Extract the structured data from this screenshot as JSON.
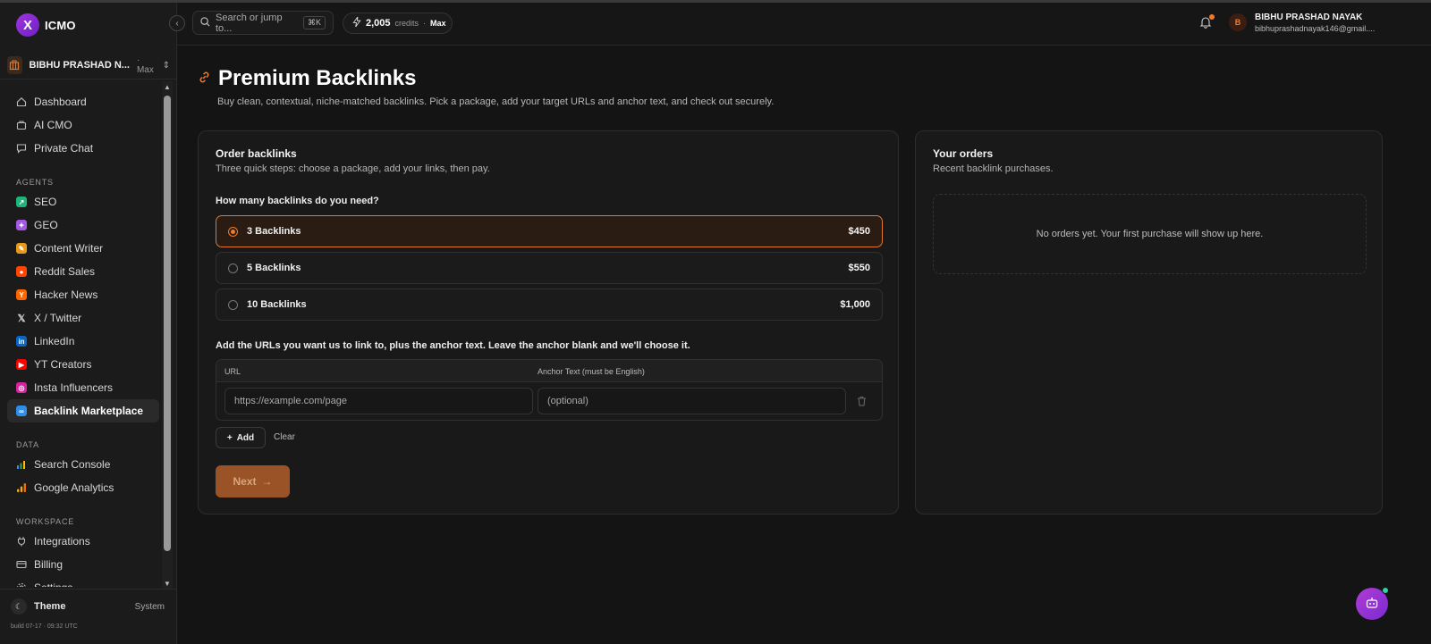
{
  "app": {
    "name": "ICMO",
    "logo_letter": "X",
    "accent": "#f07a2e"
  },
  "workspace": {
    "name": "BIBHU PRASHAD N...",
    "plan": "· Max"
  },
  "sidebar": {
    "main": [
      {
        "label": "Dashboard",
        "icon": "home-icon"
      },
      {
        "label": "AI CMO",
        "icon": "bag-icon"
      },
      {
        "label": "Private Chat",
        "icon": "chat-icon"
      }
    ],
    "agents_title": "AGENTS",
    "agents": [
      {
        "label": "SEO",
        "icon": "seo-icon",
        "color": "#1fb57a",
        "glyph": "↗"
      },
      {
        "label": "GEO",
        "icon": "geo-icon",
        "color": "#a45ae0",
        "glyph": "✦"
      },
      {
        "label": "Content Writer",
        "icon": "pen-icon",
        "color": "#e59a1d",
        "glyph": "✎"
      },
      {
        "label": "Reddit Sales",
        "icon": "reddit-icon",
        "color": "#ff4500",
        "glyph": "●"
      },
      {
        "label": "Hacker News",
        "icon": "hacker-news-icon",
        "color": "#ff6600",
        "glyph": "Y"
      },
      {
        "label": "X / Twitter",
        "icon": "x-twitter-icon",
        "color": "transparent",
        "glyph": "𝕏"
      },
      {
        "label": "LinkedIn",
        "icon": "linkedin-icon",
        "color": "#0a66c2",
        "glyph": "in"
      },
      {
        "label": "YT Creators",
        "icon": "youtube-icon",
        "color": "#ff0000",
        "glyph": "▶"
      },
      {
        "label": "Insta Influencers",
        "icon": "instagram-icon",
        "color": "#d6249f",
        "glyph": "◎"
      },
      {
        "label": "Backlink Marketplace",
        "icon": "link-icon",
        "color": "#2f8fe8",
        "glyph": "∞",
        "active": true
      }
    ],
    "data_title": "DATA",
    "data": [
      {
        "label": "Search Console",
        "icon": "search-console-icon"
      },
      {
        "label": "Google Analytics",
        "icon": "google-analytics-icon"
      }
    ],
    "workspace_title": "WORKSPACE",
    "workspace": [
      {
        "label": "Integrations",
        "icon": "plug-icon"
      },
      {
        "label": "Billing",
        "icon": "card-icon"
      },
      {
        "label": "Settings",
        "icon": "gear-icon"
      }
    ],
    "theme_label": "Theme",
    "theme_value": "System",
    "build": "build 07-17 · 09:32 UTC"
  },
  "topbar": {
    "search_placeholder": "Search or jump to...",
    "search_shortcut": "⌘K",
    "credits_value": "2,005",
    "credits_label": "credits",
    "credits_sep": "·",
    "plan": "Max",
    "user_initial": "B",
    "user_name": "BIBHU PRASHAD NAYAK",
    "user_email": "bibhuprashadnayak146@gmail...."
  },
  "page": {
    "title": "Premium Backlinks",
    "subtitle": "Buy clean, contextual, niche-matched backlinks. Pick a package, add your target URLs and anchor text, and check out securely."
  },
  "order": {
    "title": "Order backlinks",
    "subtitle": "Three quick steps: choose a package, add your links, then pay.",
    "question": "How many backlinks do you need?",
    "packages": [
      {
        "name": "3 Backlinks",
        "price": "$450",
        "selected": true
      },
      {
        "name": "5 Backlinks",
        "price": "$550",
        "selected": false
      },
      {
        "name": "10 Backlinks",
        "price": "$1,000",
        "selected": false
      }
    ],
    "urls_label": "Add the URLs you want us to link to, plus the anchor text. Leave the anchor blank and we'll choose it.",
    "col_url": "URL",
    "col_anchor": "Anchor Text (must be English)",
    "url_placeholder": "https://example.com/page",
    "anchor_placeholder": "(optional)",
    "add_label": "Add",
    "clear_label": "Clear",
    "next_label": "Next"
  },
  "orders": {
    "title": "Your orders",
    "subtitle": "Recent backlink purchases.",
    "empty": "No orders yet. Your first purchase will show up here."
  }
}
